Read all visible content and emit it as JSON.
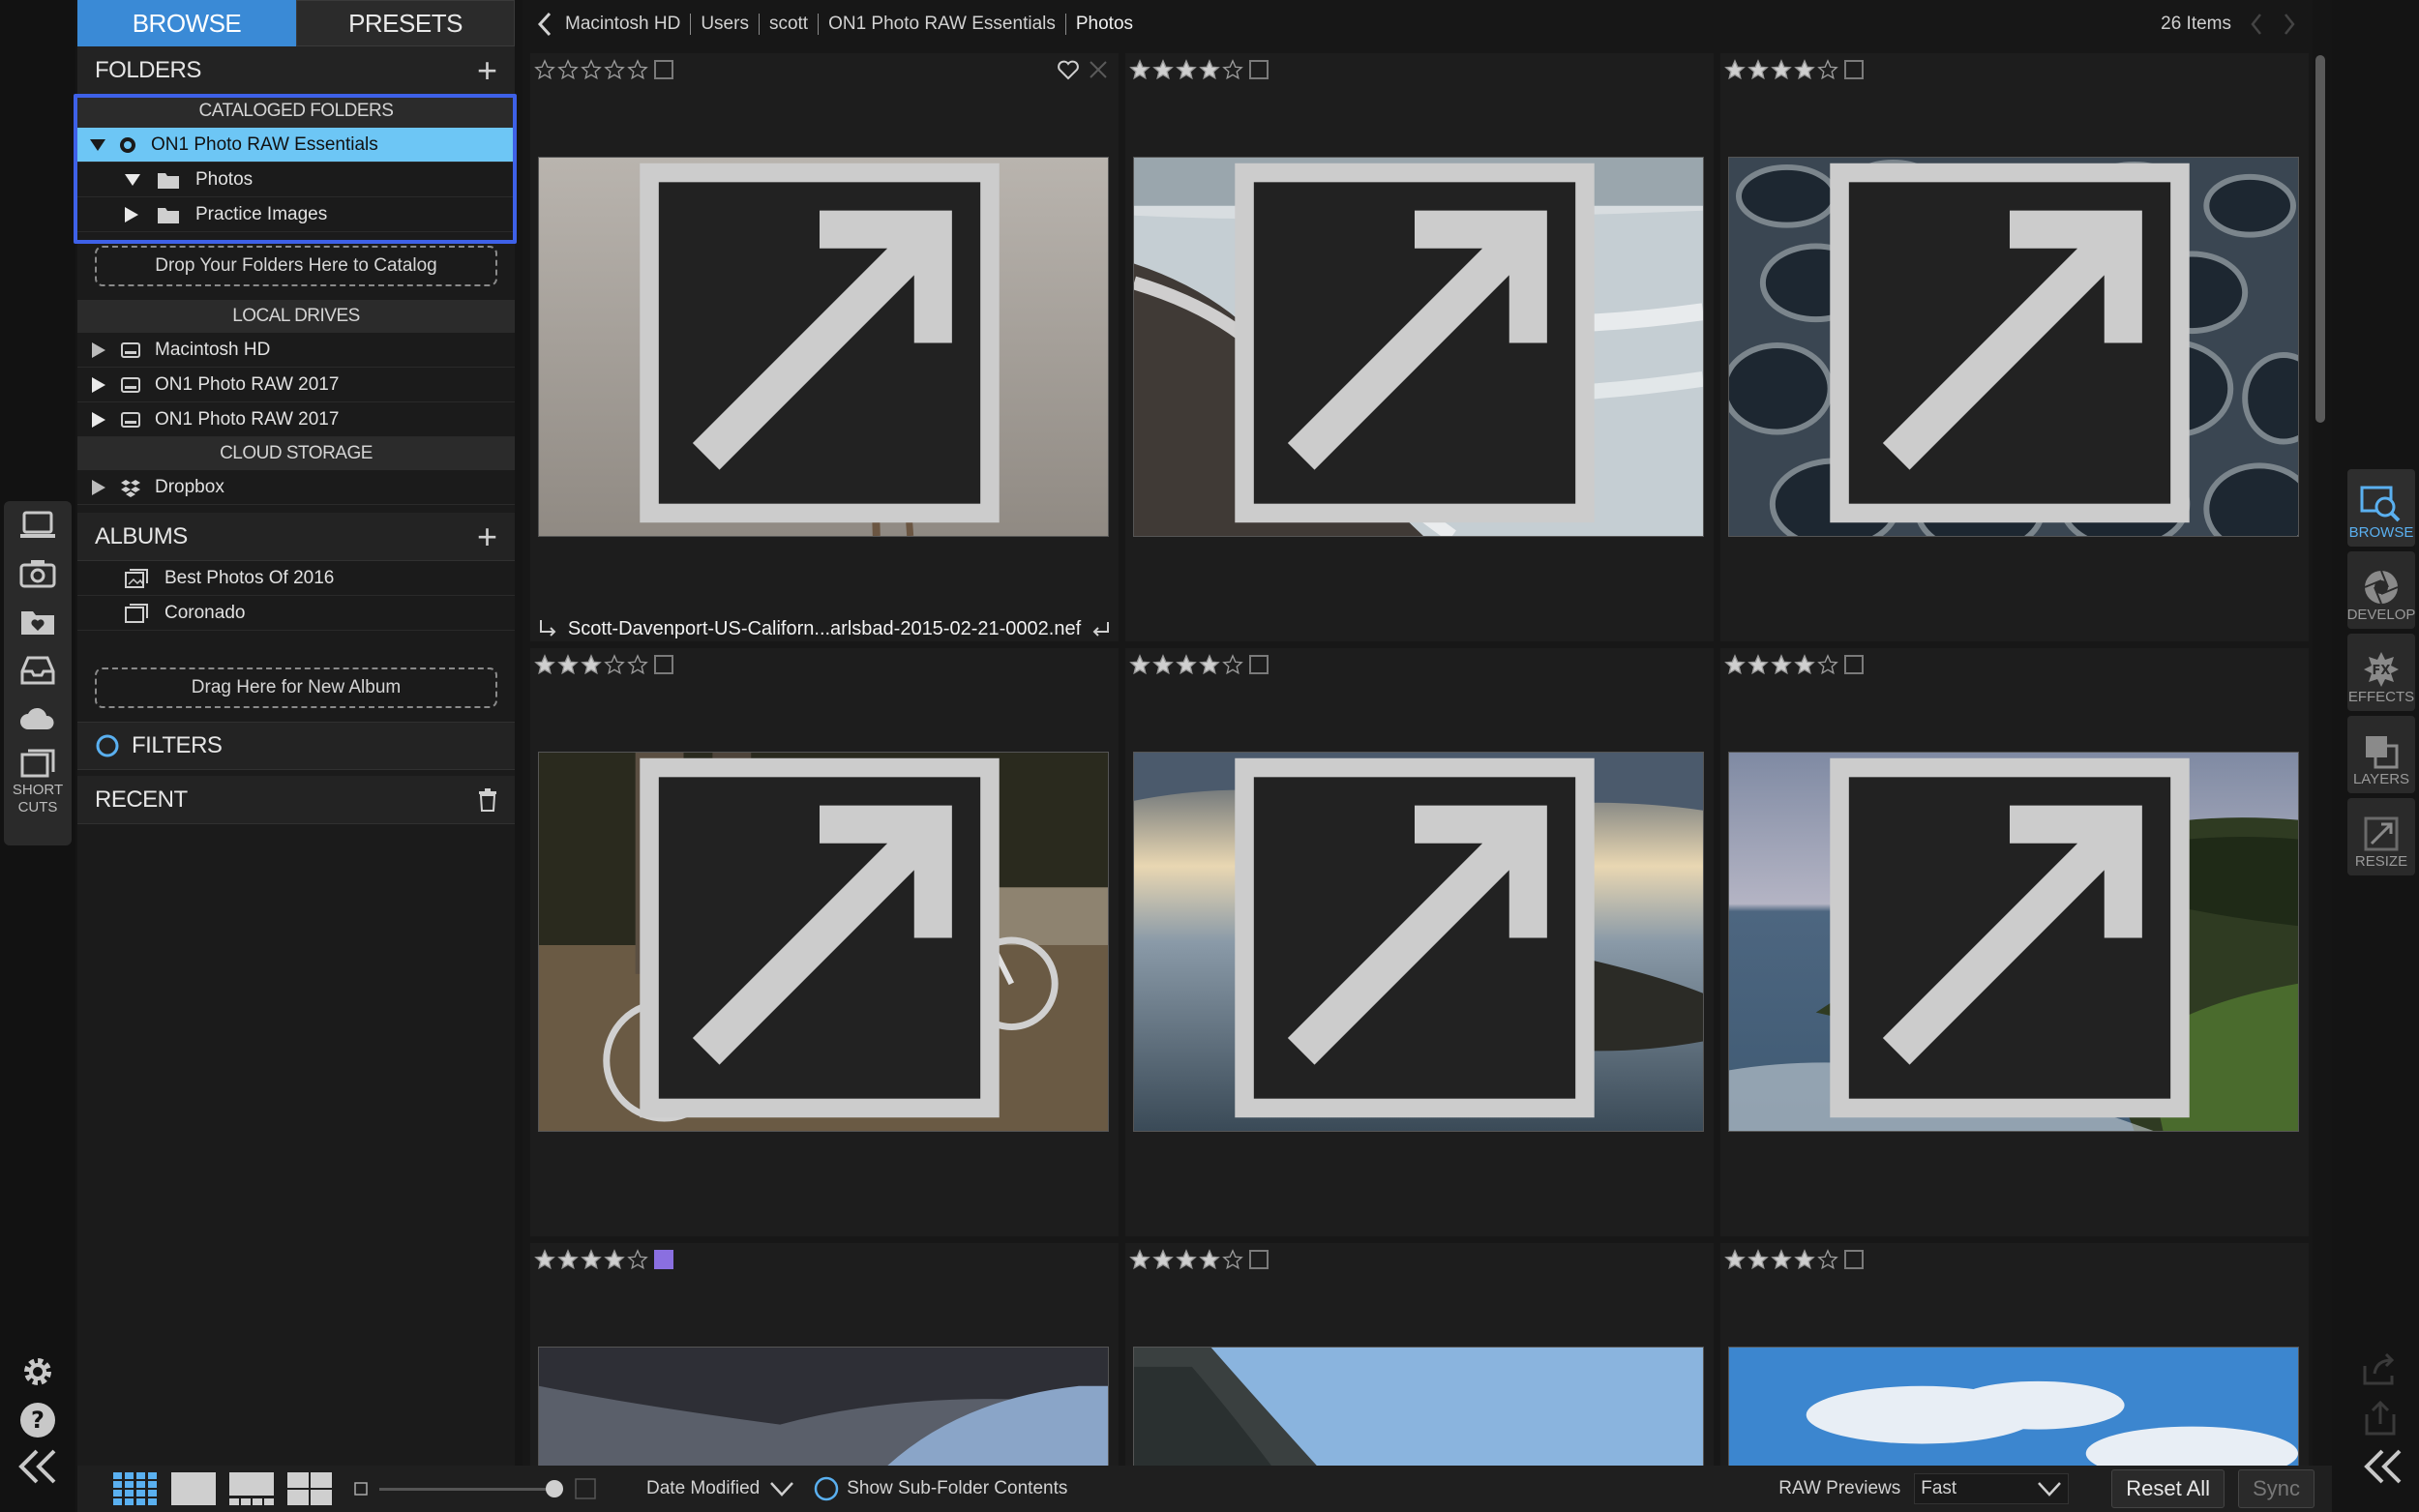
{
  "tabs": [
    "BROWSE",
    "PRESETS"
  ],
  "folders": {
    "title": "FOLDERS",
    "cataloged_title": "CATALOGED FOLDERS",
    "cataloged": [
      {
        "label": "ON1 Photo RAW Essentials",
        "selected": true
      },
      {
        "label": "Photos"
      },
      {
        "label": "Practice Images"
      }
    ],
    "drop_catalog": "Drop Your Folders Here to Catalog",
    "local_title": "LOCAL DRIVES",
    "local": [
      "Macintosh HD",
      "ON1 Photo RAW 2017",
      "ON1 Photo RAW 2017"
    ],
    "cloud_title": "CLOUD STORAGE",
    "cloud": [
      "Dropbox"
    ]
  },
  "albums": {
    "title": "ALBUMS",
    "items": [
      "Best Photos Of 2016",
      "Coronado"
    ],
    "drop_album": "Drag Here for New Album"
  },
  "filters": {
    "title": "FILTERS"
  },
  "recent": {
    "title": "RECENT"
  },
  "shortcuts_label": [
    "SHORT",
    "CUTS"
  ],
  "breadcrumb": [
    "Macintosh HD",
    "Users",
    "scott",
    "ON1 Photo RAW Essentials",
    "Photos"
  ],
  "item_count": "26 Items",
  "selected_filename": "Scott-Davenport-US-Californ...arlsbad-2015-02-21-0002.nef",
  "photos": [
    {
      "stars": 0,
      "label": "none",
      "subject": "palm-trees",
      "has_heart": true
    },
    {
      "stars": 4,
      "label": "none",
      "subject": "beach-waves"
    },
    {
      "stars": 4,
      "label": "none",
      "subject": "tide-pools"
    },
    {
      "stars": 3,
      "label": "none",
      "subject": "bicycles"
    },
    {
      "stars": 4,
      "label": "none",
      "subject": "rocky-seascape"
    },
    {
      "stars": 4,
      "label": "none",
      "subject": "lighthouse-cliff"
    },
    {
      "stars": 4,
      "label": "purple",
      "subject": "storm-sky"
    },
    {
      "stars": 4,
      "label": "none",
      "subject": "hill-sky"
    },
    {
      "stars": 4,
      "label": "none",
      "subject": "cloudy-sky"
    }
  ],
  "modules": [
    "BROWSE",
    "DEVELOP",
    "EFFECTS",
    "LAYERS",
    "RESIZE"
  ],
  "bottom": {
    "sort": "Date Modified",
    "subfolders": "Show Sub-Folder Contents",
    "raw_previews_label": "RAW Previews",
    "raw_previews_value": "Fast",
    "reset_all": "Reset All",
    "sync": "Sync"
  },
  "colors": {
    "accent": "#3a8ad6",
    "selection": "#6dc6f5",
    "outline": "#3e61e8"
  }
}
